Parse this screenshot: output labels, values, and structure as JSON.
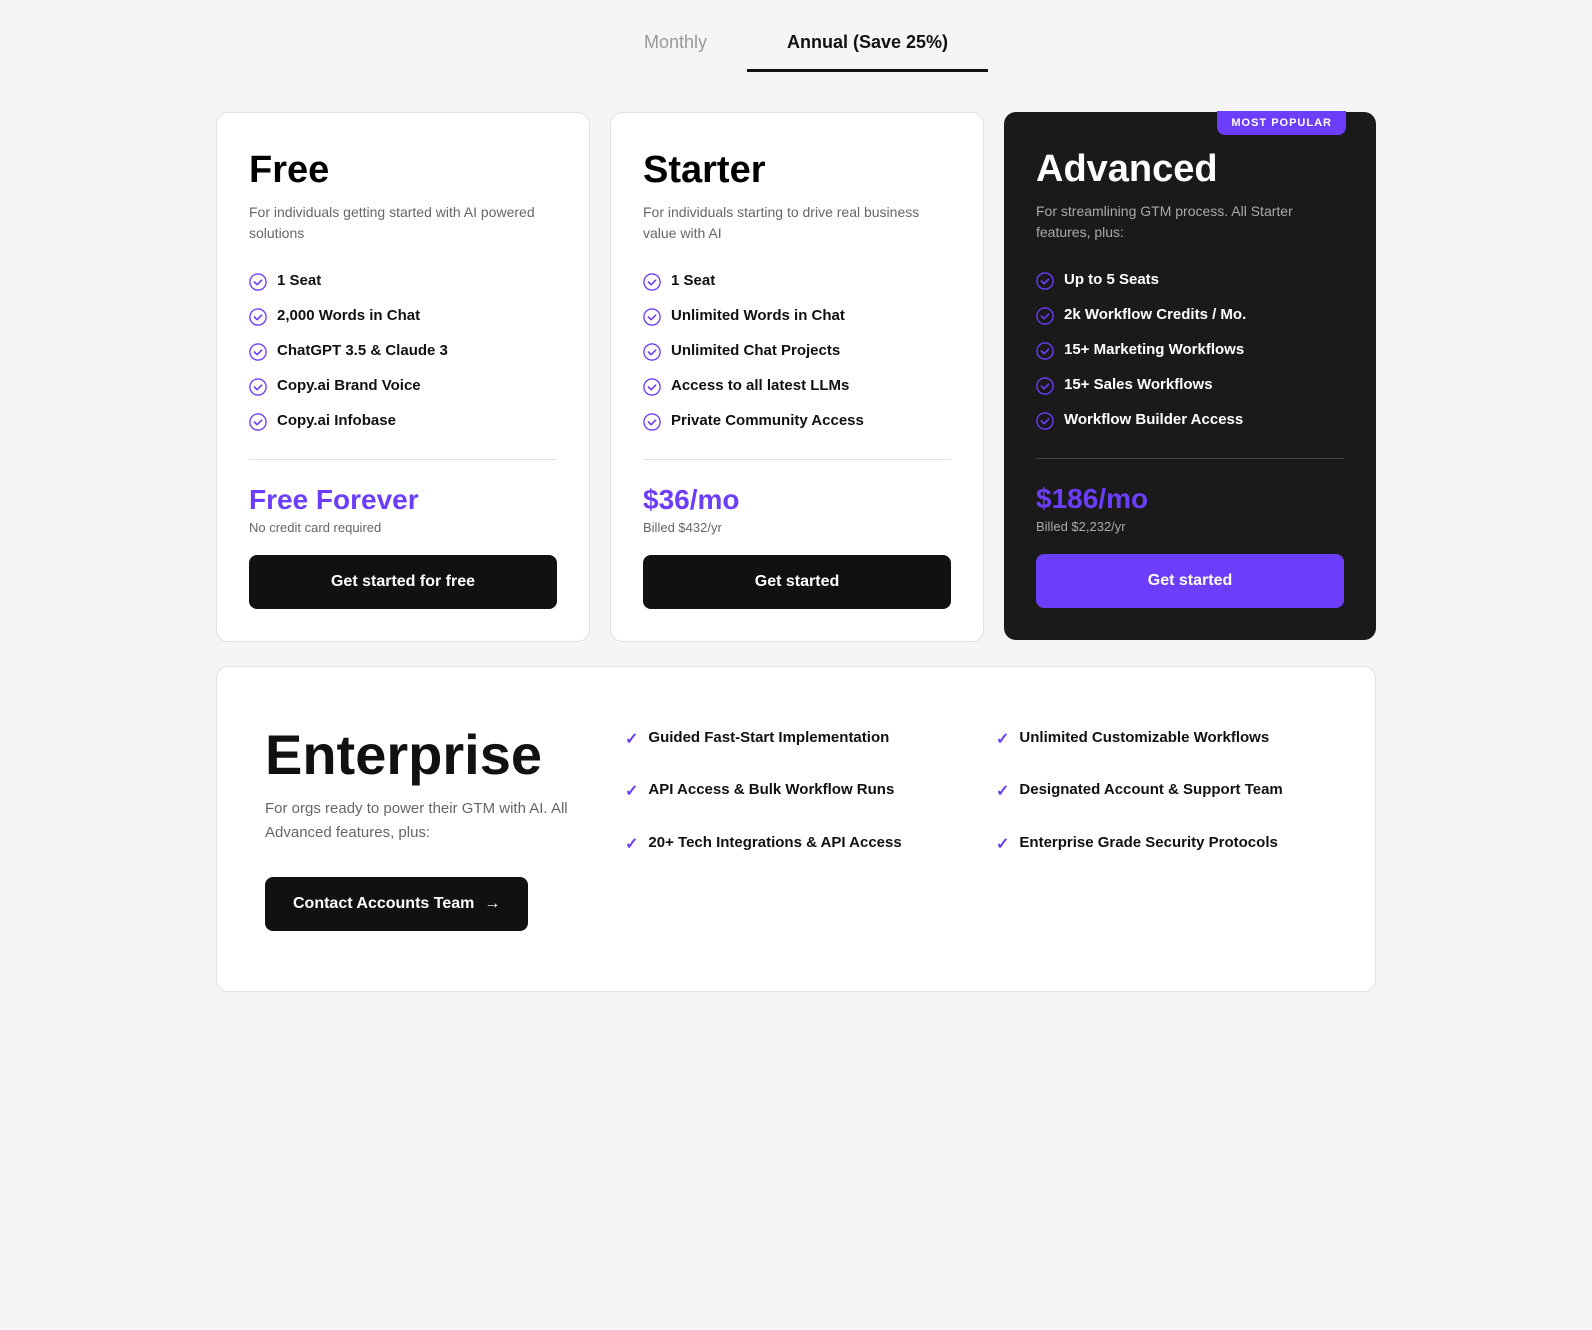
{
  "billing": {
    "monthly_label": "Monthly",
    "annual_label": "Annual (Save 25%)",
    "active_tab": "annual"
  },
  "plans": [
    {
      "id": "free",
      "title": "Free",
      "description": "For individuals getting started with AI powered solutions",
      "features": [
        "1 Seat",
        "2,000 Words in Chat",
        "ChatGPT 3.5 & Claude 3",
        "Copy.ai Brand Voice",
        "Copy.ai Infobase"
      ],
      "price_label": "Free Forever",
      "billed_note": "No credit card required",
      "button_label": "Get started for free",
      "dark": false,
      "most_popular": false
    },
    {
      "id": "starter",
      "title": "Starter",
      "description": "For individuals starting to drive real business value with AI",
      "features": [
        "1 Seat",
        "Unlimited Words in Chat",
        "Unlimited Chat Projects",
        "Access to all latest LLMs",
        "Private Community Access"
      ],
      "price_label": "$36/mo",
      "billed_note": "Billed $432/yr",
      "button_label": "Get started",
      "dark": false,
      "most_popular": false
    },
    {
      "id": "advanced",
      "title": "Advanced",
      "description": "For streamlining GTM process. All Starter features, plus:",
      "features": [
        "Up to 5 Seats",
        "2k Workflow Credits / Mo.",
        "15+ Marketing Workflows",
        "15+ Sales Workflows",
        "Workflow Builder Access"
      ],
      "price_label": "$186/mo",
      "billed_note": "Billed $2,232/yr",
      "button_label": "Get started",
      "dark": true,
      "most_popular": true,
      "badge_label": "MOST POPULAR"
    }
  ],
  "enterprise": {
    "title": "Enterprise",
    "description": "For orgs ready to power their GTM with AI. All Advanced features, plus:",
    "button_label": "Contact Accounts Team",
    "features_col1": [
      "Guided Fast-Start Implementation",
      "API Access & Bulk Workflow Runs",
      "20+ Tech Integrations & API Access"
    ],
    "features_col2": [
      "Unlimited Customizable Workflows",
      "Designated Account & Support Team",
      "Enterprise Grade Security Protocols"
    ]
  },
  "colors": {
    "purple": "#6c3efc",
    "dark_bg": "#1a1a1a"
  }
}
